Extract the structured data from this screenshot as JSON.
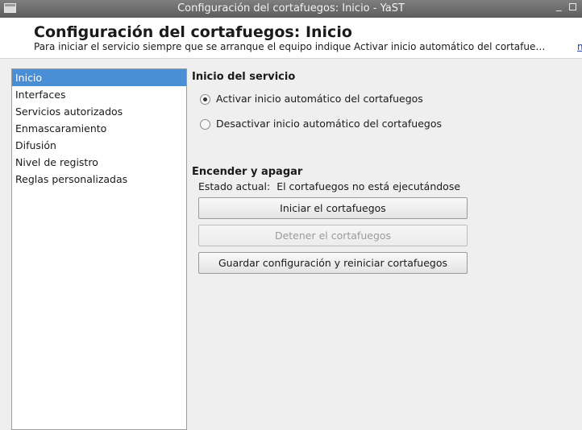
{
  "window": {
    "title": "Configuración del cortafuegos: Inicio - YaST"
  },
  "header": {
    "title": "Configuración del cortafuegos: Inicio",
    "subtitle": "Para iniciar el servicio siempre que se arranque el equipo indique Activar inicio automático del cortafue…",
    "more_link": "m"
  },
  "sidebar": {
    "items": [
      {
        "label": "Inicio",
        "selected": true
      },
      {
        "label": "Interfaces"
      },
      {
        "label": "Servicios autorizados"
      },
      {
        "label": "Enmascaramiento"
      },
      {
        "label": "Difusión"
      },
      {
        "label": "Nivel de registro"
      },
      {
        "label": "Reglas personalizadas"
      }
    ]
  },
  "service_start": {
    "title": "Inicio del servicio",
    "options": [
      {
        "label": "Activar inicio automático del cortafuegos",
        "checked": true
      },
      {
        "label": "Desactivar inicio automático del cortafuegos",
        "checked": false
      }
    ]
  },
  "power": {
    "title": "Encender y apagar",
    "status_label": "Estado actual:",
    "status_value": "El cortafuegos no está ejecutándose",
    "buttons": [
      {
        "label": "Iniciar el cortafuegos",
        "enabled": true
      },
      {
        "label": "Detener el cortafuegos",
        "enabled": false
      },
      {
        "label": "Guardar configuración y reiniciar cortafuegos",
        "enabled": true
      }
    ]
  },
  "icons": {
    "window": "window-icon",
    "minimize": "minimize-icon",
    "maximize": "maximize-icon"
  }
}
